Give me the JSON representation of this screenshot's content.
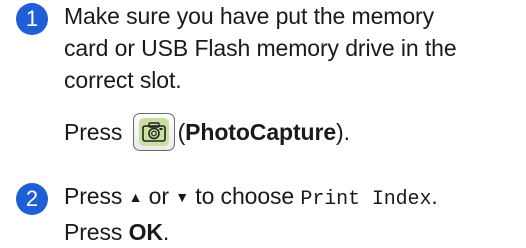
{
  "steps": [
    {
      "number": "1",
      "lines": [
        "Make sure you have put the memory",
        "card or USB Flash memory drive in the",
        "correct slot."
      ],
      "press_label": "Press",
      "button_icon": "camera-icon",
      "open_paren": "(",
      "button_name": "PhotoCapture",
      "close_paren": ")."
    },
    {
      "number": "2",
      "press_label": "Press",
      "up_arrow": "▲",
      "or_text": "or",
      "down_arrow": "▼",
      "choose_text": "to choose",
      "menu_item": "Print Index",
      "period": ".",
      "press_label_2": "Press",
      "ok_label": "OK",
      "period_2": "."
    }
  ],
  "colors": {
    "badge": "#1f5fd6",
    "button_face": "#c8dfa0"
  }
}
